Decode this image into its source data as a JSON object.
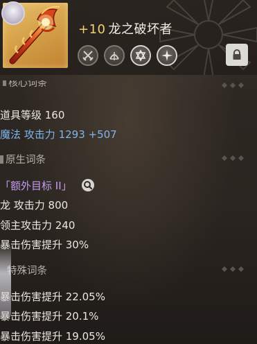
{
  "item": {
    "enhance_level": "+10",
    "name": "龙之破坏者",
    "icon": "dragon-staff-icon",
    "sockets": [
      "crossed-swords-icon",
      "bow-icon",
      "hexagram-icon",
      "sparkle-star-icon"
    ],
    "lock_icon": "lock-icon"
  },
  "core_section": {
    "partial_title": "核心词条",
    "item_level_label": "道具等级 160",
    "magic_attack_label": "魔法 攻击力",
    "magic_attack_value": "1293",
    "magic_attack_bonus": "+507"
  },
  "innate_section": {
    "title": "原生词条",
    "extra_target": "「额外目标 II」",
    "stats": [
      "龙 攻击力 800",
      "领主攻击力 240",
      "暴击伤害提升 30%"
    ]
  },
  "special_section": {
    "title": "特殊词条",
    "stats": [
      "暴击伤害提升 22.05%",
      "暴击伤害提升 20.1%",
      "暴击伤害提升 19.05%"
    ]
  },
  "colors": {
    "enhance": "#f0d277",
    "magic_attack": "#7fb5ee",
    "extra_target": "#c59cf0",
    "icon_bg": "#d6a24a"
  }
}
